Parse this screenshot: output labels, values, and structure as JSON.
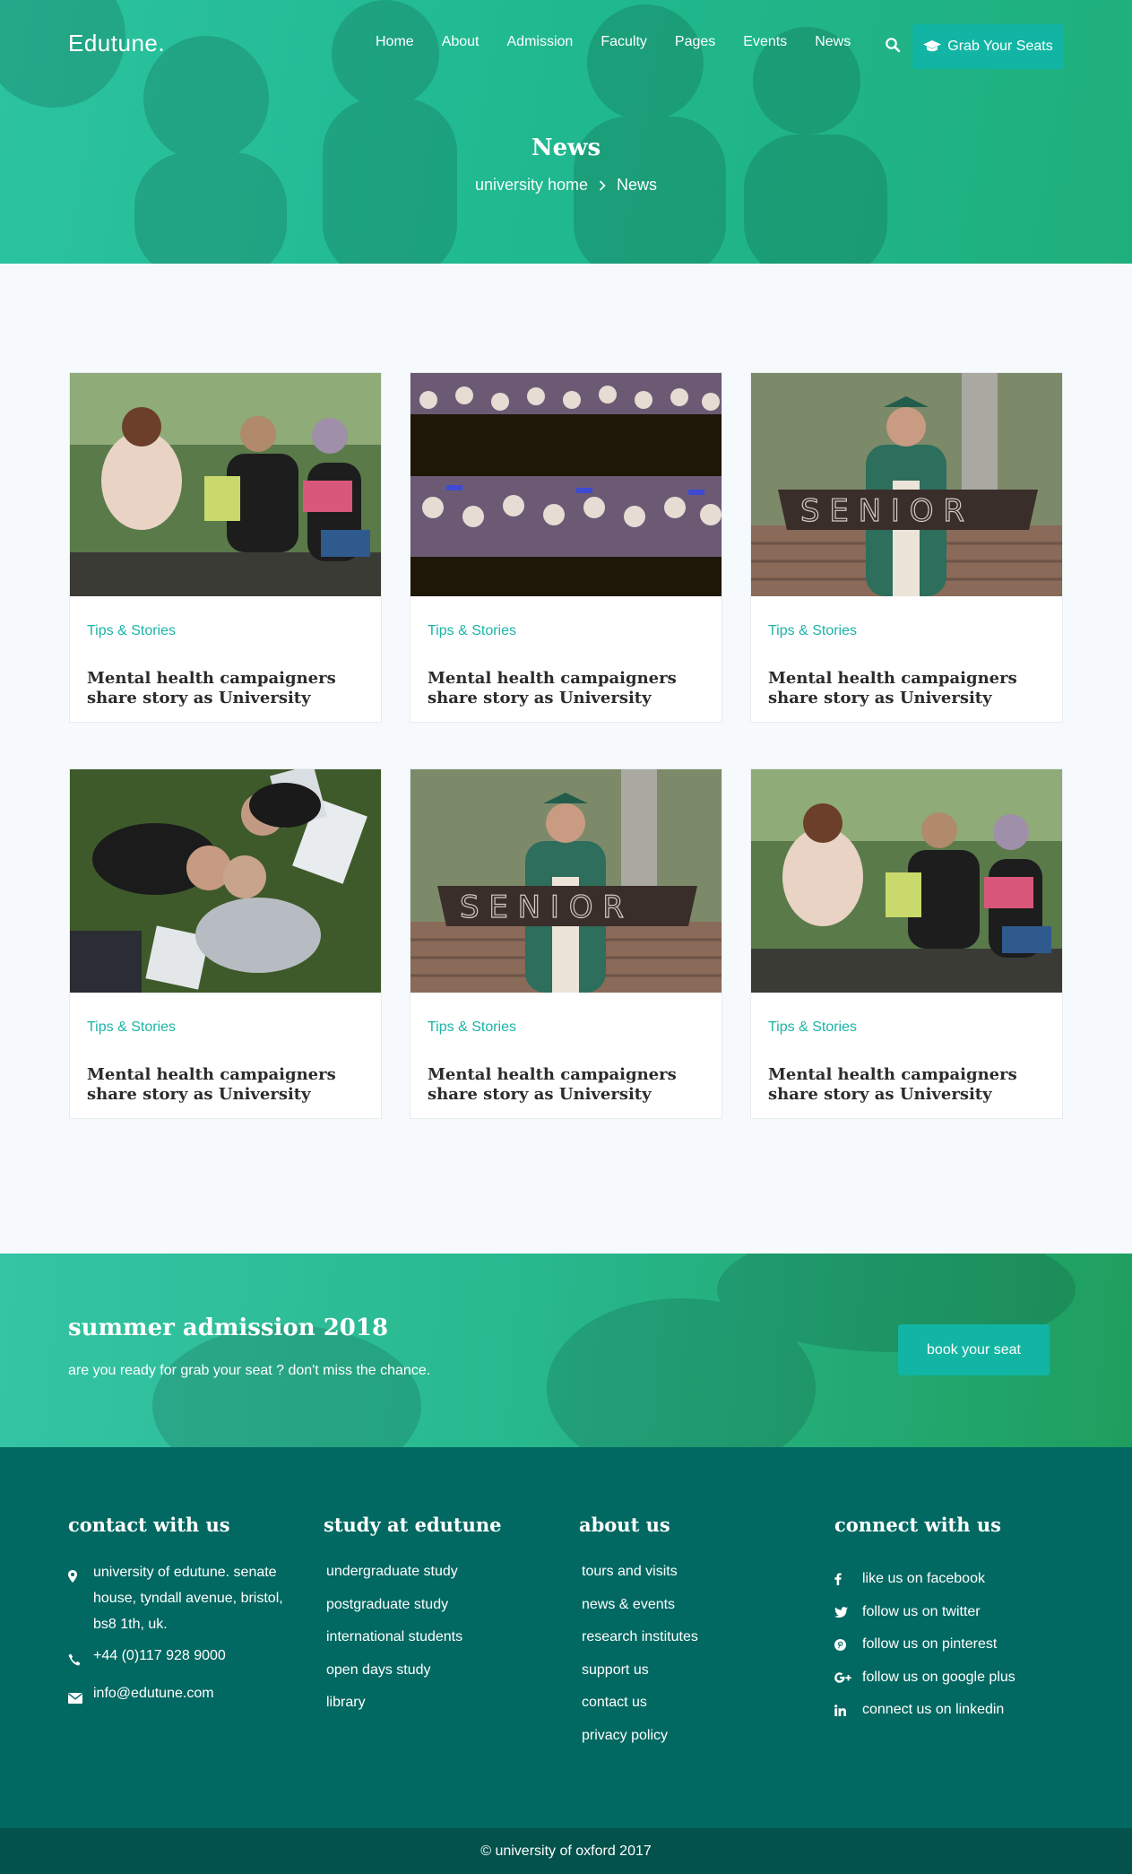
{
  "brand": {
    "logo": "Edutune.",
    "accent": "#12b5a3",
    "hero_green": "#20b990",
    "footer_bg": "#026862",
    "copyright_bg": "#03524c"
  },
  "nav": {
    "items": [
      "Home",
      "About",
      "Admission",
      "Faculty",
      "Pages",
      "Events",
      "News"
    ],
    "search_icon": "search-icon",
    "cta_label": "Grab Your Seats",
    "cta_icon": "graduation-cap-icon"
  },
  "hero": {
    "title": "News",
    "breadcrumb": {
      "home": "university home",
      "separator_icon": "chevron-right-icon",
      "current": "News"
    }
  },
  "cards": [
    {
      "category": "Tips & Stories",
      "title": "Mental health campaigners share story as University",
      "image": "students-reading-bench"
    },
    {
      "category": "Tips & Stories",
      "title": "Mental health campaigners share story as University",
      "image": "graduation-crowd"
    },
    {
      "category": "Tips & Stories",
      "title": "Mental health campaigners share story as University",
      "image": "senior-graduate-banner"
    },
    {
      "category": "Tips & Stories",
      "title": "Mental health campaigners share story as University",
      "image": "students-lying-grass"
    },
    {
      "category": "Tips & Stories",
      "title": "Mental health campaigners share story as University",
      "image": "senior-graduate-banner"
    },
    {
      "category": "Tips & Stories",
      "title": "Mental health campaigners share story as University",
      "image": "students-reading-bench"
    }
  ],
  "admission": {
    "title": "summer admission 2018",
    "subtitle": "are you ready for grab your seat ? don't miss the chance.",
    "button": "book your seat"
  },
  "footer": {
    "contact": {
      "heading": "contact with us",
      "address": "university of edutune. senate house, tyndall avenue, bristol, bs8 1th, uk.",
      "phone": "+44 (0)117 928 9000",
      "email": "info@edutune.com"
    },
    "study": {
      "heading": "study at edutune",
      "links": [
        "undergraduate study",
        "postgraduate study",
        "international students",
        "open days study",
        "library"
      ]
    },
    "about": {
      "heading": "about us",
      "links": [
        "tours and visits",
        "news & events",
        "research institutes",
        "support us",
        "contact us",
        "privacy policy"
      ]
    },
    "connect": {
      "heading": "connect with us",
      "links": [
        {
          "label": "like us on facebook",
          "icon": "facebook-icon"
        },
        {
          "label": "follow us on twitter",
          "icon": "twitter-icon"
        },
        {
          "label": "follow us on pinterest",
          "icon": "pinterest-icon"
        },
        {
          "label": "follow us on google plus",
          "icon": "google-plus-icon"
        },
        {
          "label": "connect us on linkedin",
          "icon": "linkedin-icon"
        }
      ]
    },
    "copyright": "© university of oxford 2017"
  }
}
